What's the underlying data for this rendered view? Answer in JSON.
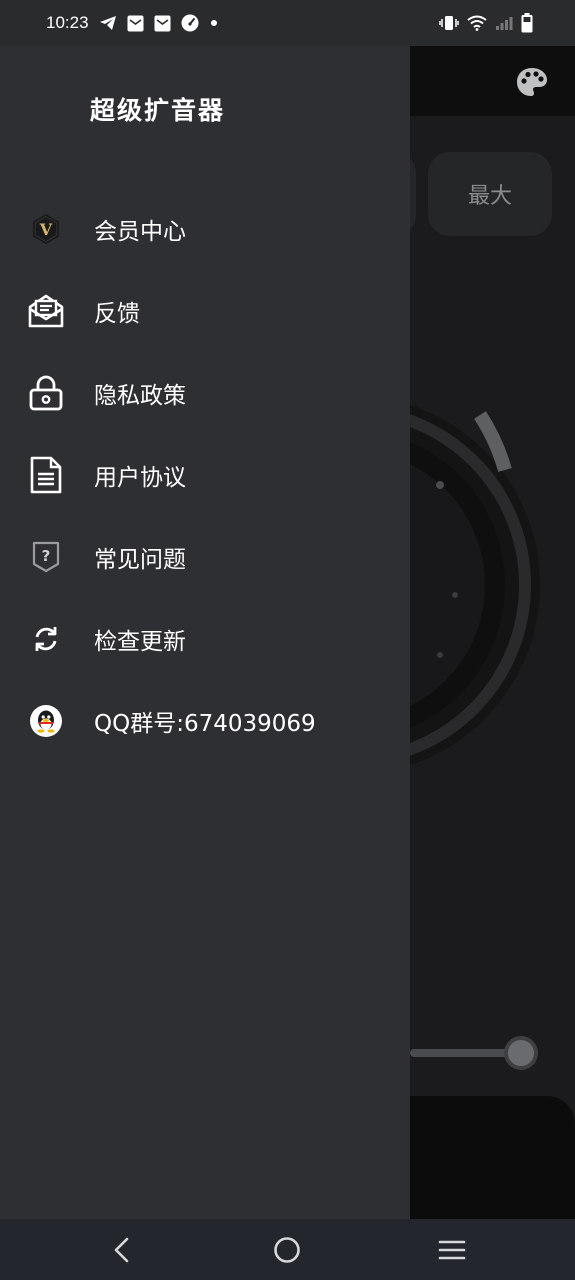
{
  "status_bar": {
    "time": "10:23",
    "left_icons": [
      "telegram-icon",
      "mail-icon",
      "mail-icon",
      "speedometer-icon",
      "dot-icon"
    ],
    "right_icons": [
      "vibrate-icon",
      "wifi-icon",
      "signal-icon",
      "battery-icon"
    ]
  },
  "drawer": {
    "title": "超级扩音器",
    "items": [
      {
        "label": "会员中心",
        "icon": "vip-badge-icon"
      },
      {
        "label": "反馈",
        "icon": "mail-open-icon"
      },
      {
        "label": "隐私政策",
        "icon": "lock-icon"
      },
      {
        "label": "用户协议",
        "icon": "document-icon"
      },
      {
        "label": "常见问题",
        "icon": "question-shield-icon"
      },
      {
        "label": "检查更新",
        "icon": "refresh-icon"
      },
      {
        "label": "QQ群号:674039069",
        "icon": "qq-penguin-icon"
      }
    ]
  },
  "background_app": {
    "max_button_label": "最大",
    "palette_icon": "palette-icon"
  },
  "nav_bar": {
    "buttons": [
      "back-icon",
      "home-icon",
      "menu-icon"
    ]
  },
  "colors": {
    "drawer_bg": "#2e2f32",
    "status_bar_bg": "#2a2b2d",
    "nav_bar_bg": "#23262c",
    "text": "#ffffff"
  }
}
